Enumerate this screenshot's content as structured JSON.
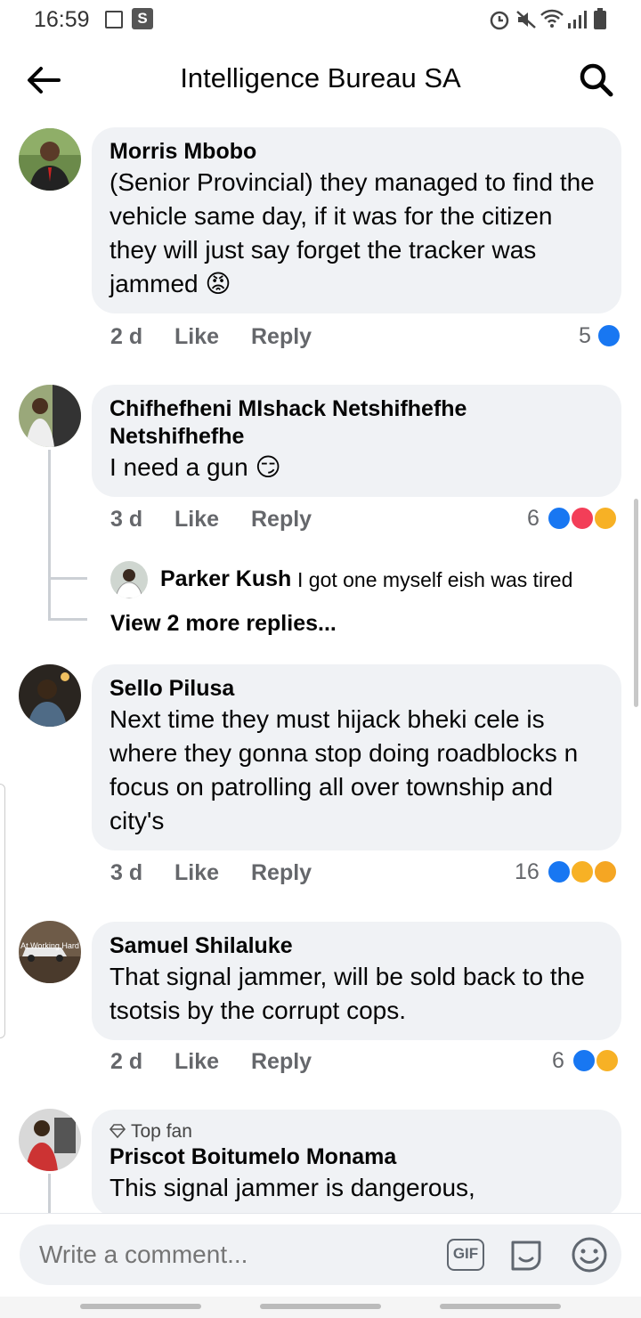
{
  "status_bar": {
    "time": "16:59",
    "s_badge": "S"
  },
  "header": {
    "title": "Intelligence Bureau SA"
  },
  "comments": [
    {
      "author": "Morris Mbobo",
      "text": "(Senior Provincial) they managed to find the vehicle same day, if it was for the citizen they will just say forget the tracker was jammed 😡",
      "time": "2 d",
      "like_label": "Like",
      "reply_label": "Reply",
      "reaction_count": "5",
      "reactions": [
        "like"
      ]
    },
    {
      "author": "Chifhefheni MIshack Netshifhefhe Netshifhefhe",
      "text": "I need a gun 😏",
      "time": "3 d",
      "like_label": "Like",
      "reply_label": "Reply",
      "reaction_count": "6",
      "reactions": [
        "like",
        "love",
        "haha"
      ],
      "reply": {
        "author": "Parker Kush",
        "text": "I got one myself eish was tired"
      },
      "view_more": "View 2 more replies..."
    },
    {
      "author": "Sello Pilusa",
      "text": "Next time they must hijack bheki cele is where they gonna stop doing roadblocks n focus on patrolling all over township and city's",
      "time": "3 d",
      "like_label": "Like",
      "reply_label": "Reply",
      "reaction_count": "16",
      "reactions": [
        "like",
        "haha",
        "care"
      ]
    },
    {
      "author": "Samuel Shilaluke",
      "avatar_text": "At Working Hard",
      "text": "That signal jammer, will be sold back to the tsotsis by the corrupt cops.",
      "time": "2 d",
      "like_label": "Like",
      "reply_label": "Reply",
      "reaction_count": "6",
      "reactions": [
        "like",
        "sad"
      ]
    },
    {
      "badge": "Top fan",
      "author": "Priscot Boitumelo Monama",
      "text": "This signal jammer is dangerous,"
    }
  ],
  "composer": {
    "placeholder": "Write a comment...",
    "gif_label": "GIF"
  }
}
